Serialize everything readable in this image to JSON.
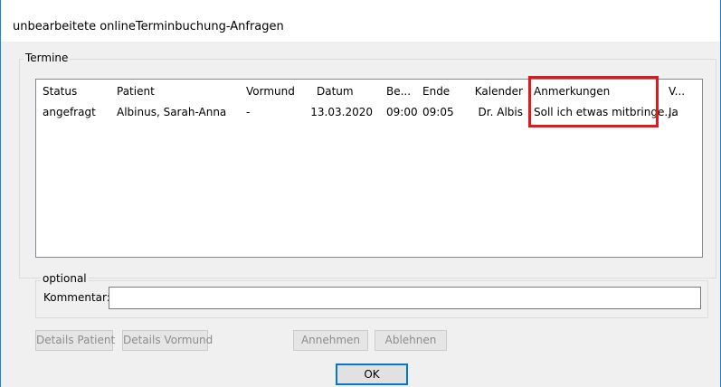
{
  "window": {
    "title": "unbearbeitete onlineTerminbuchung-Anfragen"
  },
  "termine": {
    "legend": "Termine",
    "columns": [
      "Status",
      "Patient",
      "Vormund",
      "Datum",
      "Be...",
      "Ende",
      "Kalender",
      "Anmerkungen",
      "V..."
    ],
    "rows": [
      [
        "angefragt",
        "Albinus, Sarah-Anna",
        "-",
        "13.03.2020",
        "09:00",
        "09:05",
        "Dr. Albis",
        "Soll ich etwas mitbringe...",
        "Ja"
      ]
    ],
    "highlight_color": "#e0191f"
  },
  "optional": {
    "legend": "optional",
    "kommentar_label": "Kommentar:",
    "kommentar_value": ""
  },
  "buttons": {
    "details_patient": "Details Patient",
    "details_vormund": "Details Vormund",
    "annehmen": "Annehmen",
    "ablehnen": "Ablehnen",
    "ok": "OK"
  },
  "colors": {
    "window_border": "#1883d7",
    "ok_border": "#0078d7"
  }
}
